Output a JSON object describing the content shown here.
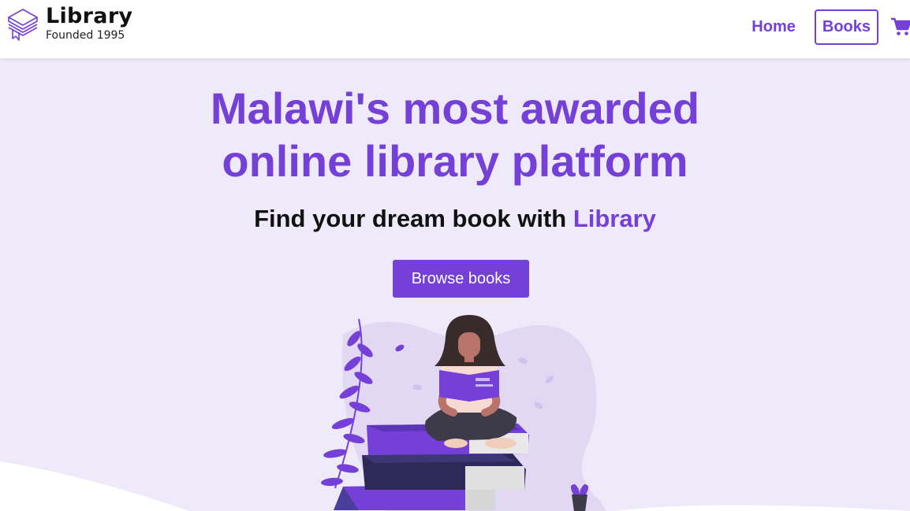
{
  "brand": {
    "title": "Library",
    "subtitle": "Founded 1995",
    "logo_icon": "books-stack-icon",
    "accent_color": "#7440d8"
  },
  "nav": {
    "home_label": "Home",
    "books_label": "Books",
    "cart_icon": "cart-icon"
  },
  "hero": {
    "title_line1": "Malawi's most awarded",
    "title_line2": "online library platform",
    "subtitle_prefix": "Find your dream book with ",
    "subtitle_accent": "Library",
    "cta_label": "Browse books",
    "background_color": "#efeaf9"
  }
}
